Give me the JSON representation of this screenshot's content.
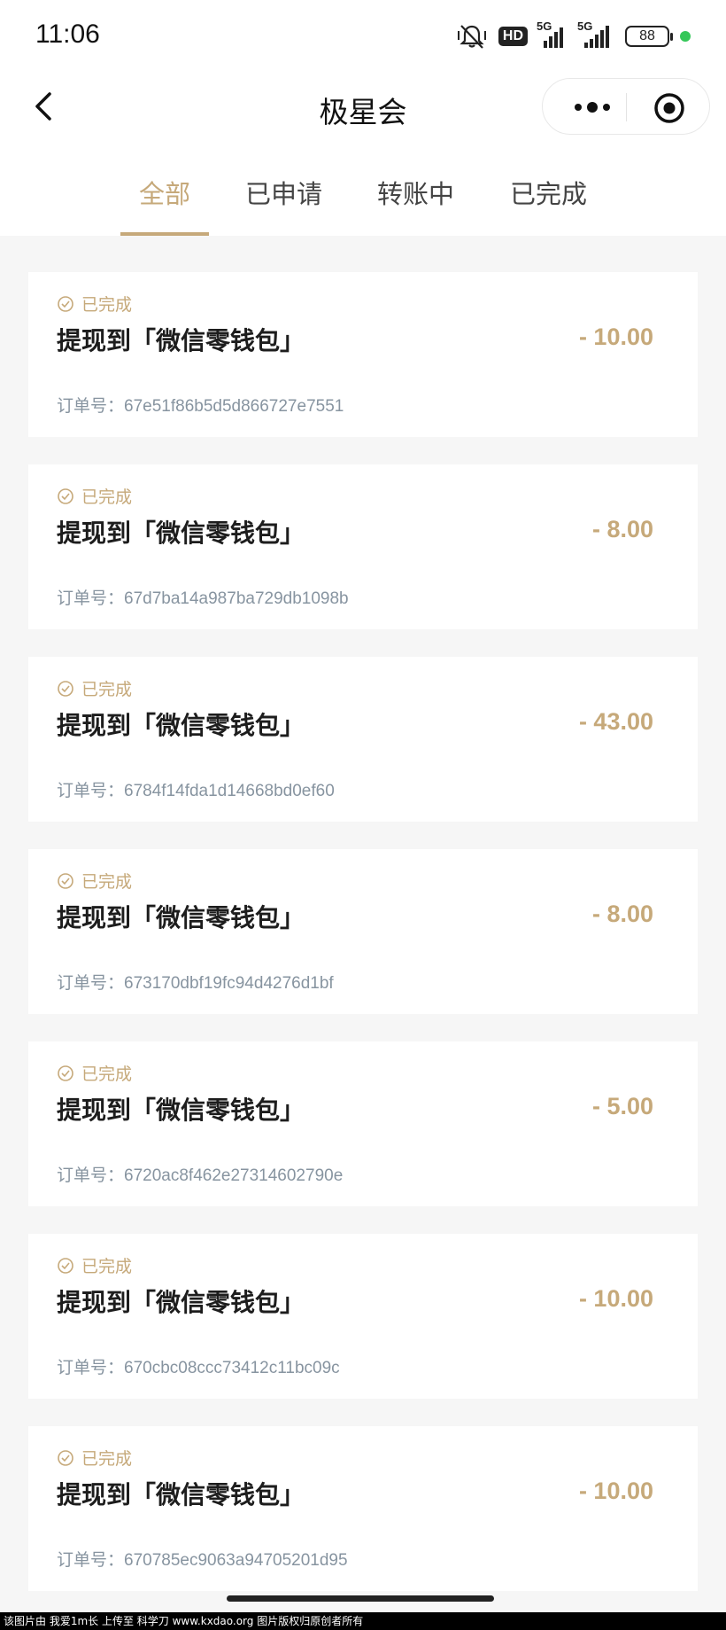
{
  "status_bar": {
    "time": "11:06",
    "network_badge": "HD",
    "signal1_label": "5G",
    "signal2_label": "5G",
    "battery": "88",
    "indicator_color": "#35c759"
  },
  "nav": {
    "title": "极星会"
  },
  "tabs": [
    {
      "label": "全部",
      "active": true
    },
    {
      "label": "已申请",
      "active": false
    },
    {
      "label": "转账中",
      "active": false
    },
    {
      "label": "已完成",
      "active": false
    }
  ],
  "records": [
    {
      "status": "已完成",
      "title": "提现到「微信零钱包」",
      "amount": "- 10.00",
      "order_label": "订单号：",
      "order_no": "67e51f86b5d5d866727e7551"
    },
    {
      "status": "已完成",
      "title": "提现到「微信零钱包」",
      "amount": "- 8.00",
      "order_label": "订单号：",
      "order_no": "67d7ba14a987ba729db1098b"
    },
    {
      "status": "已完成",
      "title": "提现到「微信零钱包」",
      "amount": "- 43.00",
      "order_label": "订单号：",
      "order_no": "6784f14fda1d14668bd0ef60"
    },
    {
      "status": "已完成",
      "title": "提现到「微信零钱包」",
      "amount": "- 8.00",
      "order_label": "订单号：",
      "order_no": "673170dbf19fc94d4276d1bf"
    },
    {
      "status": "已完成",
      "title": "提现到「微信零钱包」",
      "amount": "- 5.00",
      "order_label": "订单号：",
      "order_no": "6720ac8f462e27314602790e"
    },
    {
      "status": "已完成",
      "title": "提现到「微信零钱包」",
      "amount": "- 10.00",
      "order_label": "订单号：",
      "order_no": "670cbc08ccc73412c11bc09c"
    },
    {
      "status": "已完成",
      "title": "提现到「微信零钱包」",
      "amount": "- 10.00",
      "order_label": "订单号：",
      "order_no": "670785ec9063a94705201d95"
    }
  ],
  "watermark": "该图片由 我爱1m长 上传至 科学刀 www.kxdao.org 图片版权归原创者所有",
  "colors": {
    "accent": "#c6a97a",
    "order_text": "#8794a0",
    "background": "#f6f6f6"
  }
}
